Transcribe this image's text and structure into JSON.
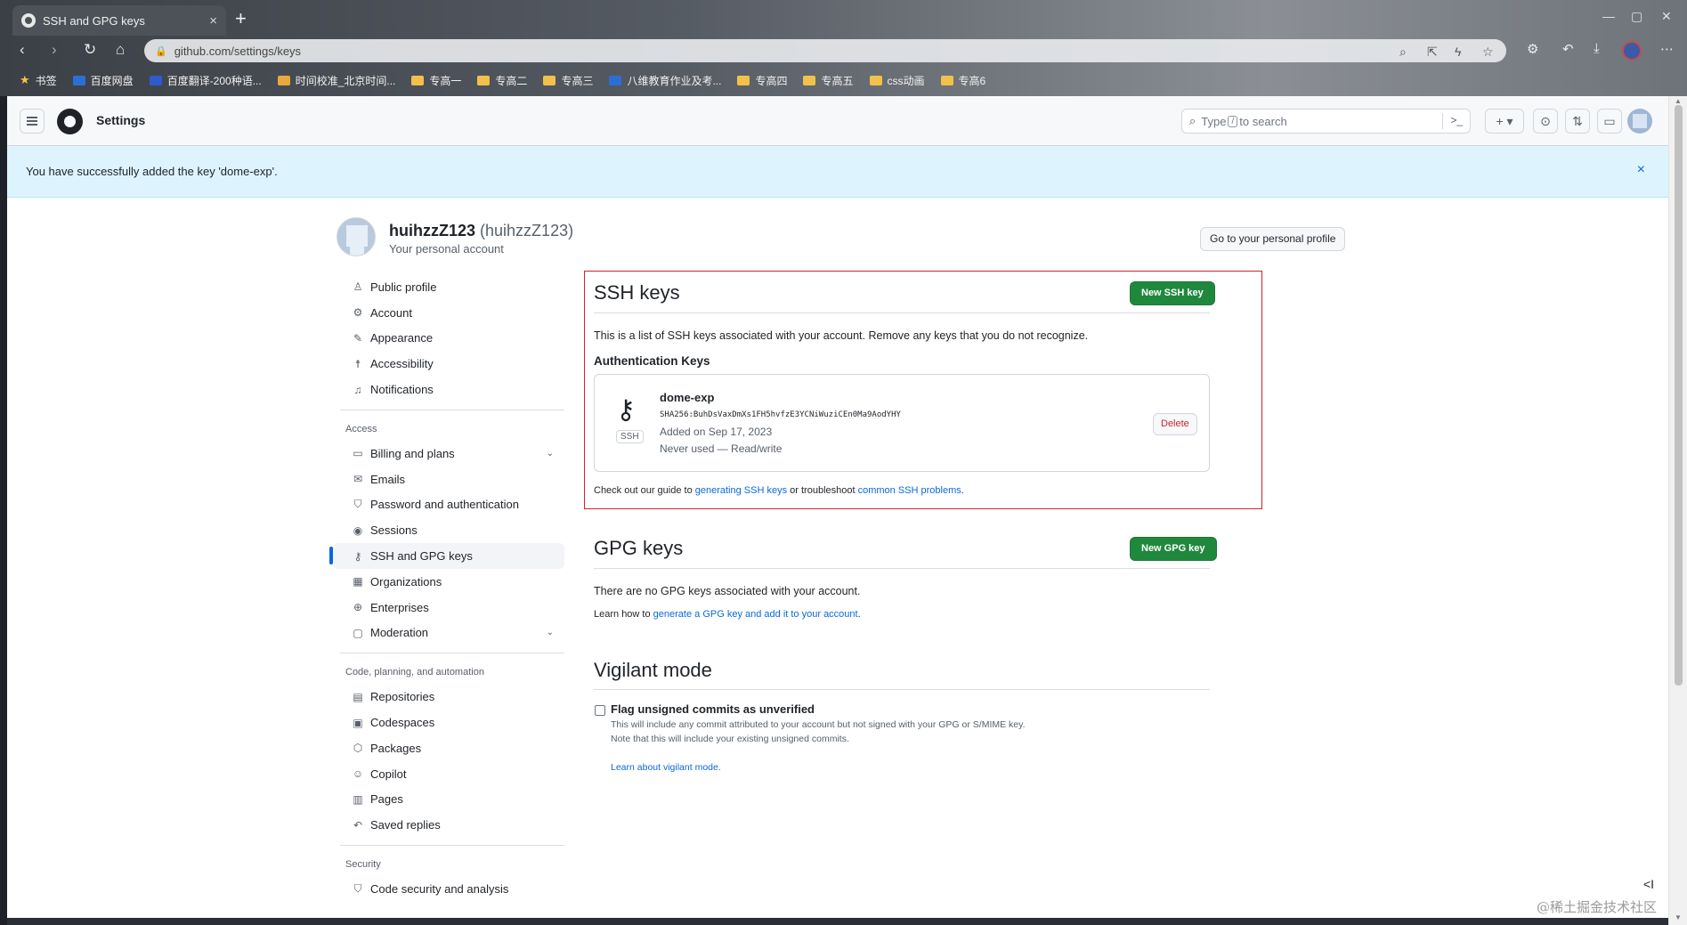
{
  "browser": {
    "tab_title": "SSH and GPG keys",
    "tab_close": "×",
    "new_tab": "+",
    "url": "github.com/settings/keys",
    "bookmarks": [
      {
        "label": "书签",
        "icon": "star-icon"
      },
      {
        "label": "百度网盘",
        "icon": "cloud-icon"
      },
      {
        "label": "百度翻译-200种语...",
        "icon": "translate-icon"
      },
      {
        "label": "时间校准_北京时间...",
        "icon": "clock-icon"
      },
      {
        "label": "专高一",
        "icon": "folder-icon"
      },
      {
        "label": "专高二",
        "icon": "folder-icon"
      },
      {
        "label": "专高三",
        "icon": "folder-icon"
      },
      {
        "label": "八维教育作业及考...",
        "icon": "page-icon"
      },
      {
        "label": "专高四",
        "icon": "folder-icon"
      },
      {
        "label": "专高五",
        "icon": "folder-icon"
      },
      {
        "label": "css动画",
        "icon": "folder-icon"
      },
      {
        "label": "专高6",
        "icon": "folder-icon"
      }
    ]
  },
  "header": {
    "title": "Settings",
    "search_prefix": "Type",
    "search_slash": "/",
    "search_suffix": "to search",
    "command_glyph": ">_",
    "plus_glyph": "+ ▾"
  },
  "flash": {
    "message": "You have successfully added the key 'dome-exp'.",
    "close": "×"
  },
  "account": {
    "name": "huihzzZ123",
    "login": "(huihzzZ123)",
    "subtitle": "Your personal account",
    "profile_button": "Go to your personal profile"
  },
  "sidebar": {
    "top_items": [
      {
        "label": "Public profile",
        "icon": "person-icon",
        "glyph": "♙"
      },
      {
        "label": "Account",
        "icon": "gear-icon",
        "glyph": "⚙"
      },
      {
        "label": "Appearance",
        "icon": "paintbrush-icon",
        "glyph": "✎"
      },
      {
        "label": "Accessibility",
        "icon": "accessibility-icon",
        "glyph": "☨"
      },
      {
        "label": "Notifications",
        "icon": "bell-icon",
        "glyph": "♫"
      }
    ],
    "access_heading": "Access",
    "access_items": [
      {
        "label": "Billing and plans",
        "icon": "credit-card-icon",
        "glyph": "▭",
        "caret": "⌄"
      },
      {
        "label": "Emails",
        "icon": "mail-icon",
        "glyph": "✉"
      },
      {
        "label": "Password and authentication",
        "icon": "shield-lock-icon",
        "glyph": "⛉"
      },
      {
        "label": "Sessions",
        "icon": "broadcast-icon",
        "glyph": "◉"
      },
      {
        "label": "SSH and GPG keys",
        "icon": "key-icon",
        "glyph": "⚷",
        "active": true
      },
      {
        "label": "Organizations",
        "icon": "organization-icon",
        "glyph": "▦"
      },
      {
        "label": "Enterprises",
        "icon": "globe-icon",
        "glyph": "⊕"
      },
      {
        "label": "Moderation",
        "icon": "report-icon",
        "glyph": "▢",
        "caret": "⌄"
      }
    ],
    "code_heading": "Code, planning, and automation",
    "code_items": [
      {
        "label": "Repositories",
        "icon": "repo-icon",
        "glyph": "▤"
      },
      {
        "label": "Codespaces",
        "icon": "codespaces-icon",
        "glyph": "▣"
      },
      {
        "label": "Packages",
        "icon": "package-icon",
        "glyph": "⬡"
      },
      {
        "label": "Copilot",
        "icon": "copilot-icon",
        "glyph": "☺"
      },
      {
        "label": "Pages",
        "icon": "browser-icon",
        "glyph": "▥"
      },
      {
        "label": "Saved replies",
        "icon": "reply-icon",
        "glyph": "↶"
      }
    ],
    "security_heading": "Security",
    "security_items": [
      {
        "label": "Code security and analysis",
        "icon": "shield-icon",
        "glyph": "⛉"
      }
    ]
  },
  "ssh": {
    "title": "SSH keys",
    "new_button": "New SSH key",
    "description": "This is a list of SSH keys associated with your account. Remove any keys that you do not recognize.",
    "auth_heading": "Authentication Keys",
    "key": {
      "title": "dome-exp",
      "badge": "SSH",
      "fingerprint": "SHA256:BuhDsVaxDmXs1FH5hvfzE3YCNiWuziCEn0Ma9AodYHY",
      "added": "Added on Sep 17, 2023",
      "usage": "Never used — Read/write",
      "delete_button": "Delete"
    },
    "guide_prefix": "Check out our guide to",
    "guide_link1": "generating SSH keys",
    "guide_middle": "or troubleshoot",
    "guide_link2": "common SSH problems",
    "guide_suffix": "."
  },
  "gpg": {
    "title": "GPG keys",
    "new_button": "New GPG key",
    "empty": "There are no GPG keys associated with your account.",
    "learn_prefix": "Learn how to",
    "learn_link": "generate a GPG key and add it to your account",
    "learn_suffix": "."
  },
  "vigilant": {
    "title": "Vigilant mode",
    "checkbox_label": "Flag unsigned commits as unverified",
    "checked": false,
    "note1": "This will include any commit attributed to your account but not signed with your GPG or S/MIME key.",
    "note2": "Note that this will include your existing unsigned commits.",
    "learn_link": "Learn about vigilant mode."
  },
  "footer": {
    "collapse_glyph": "<I",
    "watermark": "@稀土掘金技术社区"
  },
  "colors": {
    "accent": "#0969da",
    "primary_button": "#1f883d",
    "danger": "#cf222e",
    "flash_bg": "#ddf4ff",
    "highlight_border": "#cf222e"
  }
}
